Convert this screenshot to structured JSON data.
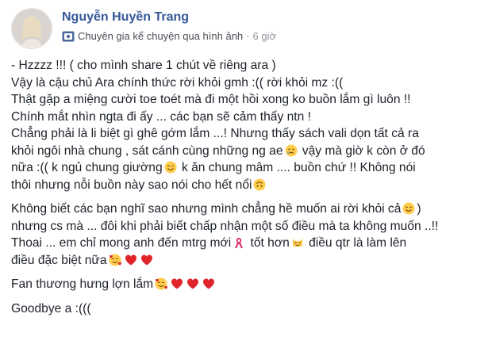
{
  "post": {
    "author_name": "Nguyễn Huyền Trang",
    "badge_label": "Chuyên gia kể chuyện qua hình ảnh",
    "separator": "·",
    "time": "6 giờ"
  },
  "paragraphs": [
    {
      "lines": [
        [
          "- Hzzzz !!! ( cho mình share 1 chút về riêng ara )"
        ],
        [
          "Vậy là cậu chủ Ara chính thức rời khỏi gmh :(( rời khỏi mz :(("
        ],
        [
          "Thật gặp a miệng cười toe toét mà đi một hồi xong ko buồn lắm gì luôn !!"
        ],
        [
          "Chính mắt nhìn ngta đi ấy ... các bạn sẽ cảm thấy ntn !"
        ],
        [
          "Chẳng phải là li biệt gì ghê gớm lắm ...! Nhưng thấy sách vali dọn tất cả ra"
        ],
        [
          "khỏi ngôi nhà chung , sát cánh cùng những ng ae",
          "sad-face-emoji",
          " vậy mà giờ k còn ở đó"
        ],
        [
          "nữa :(( k ngủ chung giường",
          "smile-emoji",
          " k ăn chung mâm .... buồn chứ !! Không nói"
        ],
        [
          "thôi nhưng nỗi buồn này sao nói cho hết nổi",
          "upside-down-emoji"
        ]
      ]
    },
    {
      "lines": [
        [
          "Không biết các bạn nghĩ sao nhưng mình chẳng hề muốn ai rời khỏi cả",
          "smile-emoji",
          ")"
        ],
        [
          "nhưng cs mà ... đôi khi phải biết chấp nhận một số điều mà ta không muốn ..!!"
        ],
        [
          "Thoai ... em chỉ mong anh đến mtrg mới",
          "ribbon-emoji",
          " tốt hơn",
          "cat-emoji",
          " điều qtr là làm lên"
        ],
        [
          "điều đặc biệt nữa",
          "hearts-face-emoji",
          "heart-emoji",
          "heart-emoji"
        ]
      ]
    },
    {
      "lines": [
        [
          "Fan thương hưng lợn lắm",
          "hearts-face-emoji",
          "heart-emoji",
          "heart-emoji",
          "heart-emoji"
        ]
      ]
    },
    {
      "lines": [
        [
          "Goodbye a :((("
        ]
      ]
    }
  ],
  "colors": {
    "author": "#365899",
    "meta": "#90949c",
    "text": "#1d2129",
    "heart": "#e0242c",
    "emoji_yellow": "#ffcc4d"
  }
}
